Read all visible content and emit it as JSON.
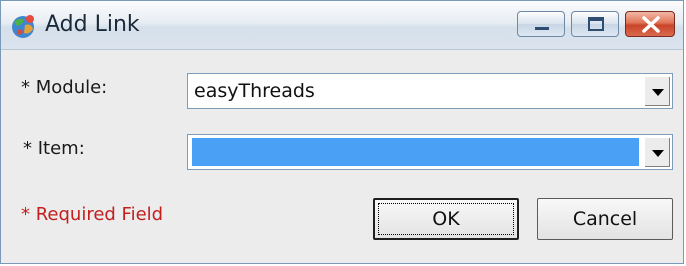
{
  "window": {
    "title": "Add Link",
    "icon": "app-globe-icon"
  },
  "controls": {
    "minimize": "minimize-icon",
    "maximize": "maximize-icon",
    "close": "close-icon"
  },
  "form": {
    "module_label": "* Module:",
    "module_value": "easyThreads",
    "item_label": "* Item:",
    "item_value": ""
  },
  "footer": {
    "required_text": "* Required Field",
    "ok_label": "OK",
    "cancel_label": "Cancel"
  },
  "colors": {
    "required": "#c41e1e",
    "selection": "#4aa0f4"
  }
}
